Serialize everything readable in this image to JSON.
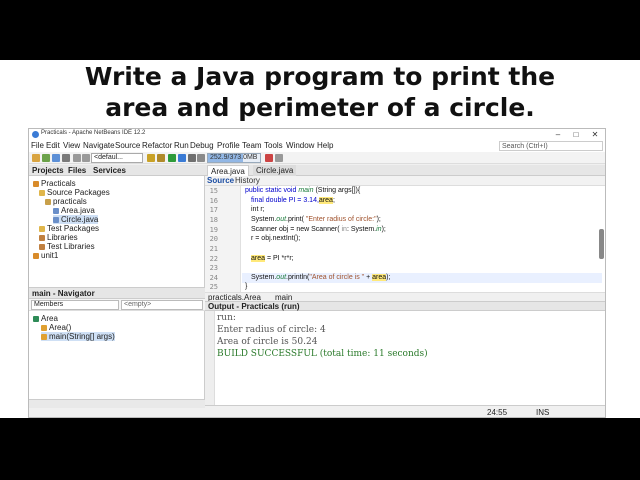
{
  "banner": {
    "line1": "Write a Java program to print the",
    "line2": "area and perimeter of a circle."
  },
  "window": {
    "title": "Practicals - Apache NetBeans IDE 12.2",
    "min": "–",
    "max": "□",
    "close": "✕"
  },
  "menu": [
    "File",
    "Edit",
    "View",
    "Navigate",
    "Source",
    "Refactor",
    "Run",
    "Debug",
    "Profile",
    "Team",
    "Tools",
    "Window",
    "Help"
  ],
  "search": {
    "placeholder": "Search (Ctrl+I)"
  },
  "toolbar": {
    "config": "<defaul...",
    "memory": "252.9/373.0MB",
    "memory_fraction": 0.68
  },
  "projects": {
    "tabs": [
      "Projects",
      "Files",
      "Services"
    ],
    "tree": [
      "Practicals",
      "Source Packages",
      "practicals",
      "Area.java",
      "Circle.java",
      "Test Packages",
      "Libraries",
      "Test Libraries",
      "unit1"
    ]
  },
  "navigator": {
    "title": "main - Navigator",
    "members": "Members",
    "empty": "<empty>",
    "tree": [
      "Area",
      "Area()",
      "main(String[] args)"
    ]
  },
  "editor": {
    "tabs": [
      "Area.java",
      "Circle.java"
    ],
    "source": "Source",
    "history": "History",
    "line_numbers": [
      "15",
      "16",
      "17",
      "18",
      "19",
      "20",
      "21",
      "22",
      "23",
      "24",
      "25"
    ],
    "code": {
      "l15a": "public static void ",
      "l15b": "main",
      "l15c": " (String args[]){",
      "l16a": "final  double PI = 3.14,",
      "l16b": "area",
      "l17": "int r;",
      "l18a": "System.",
      "l18b": "out",
      "l18c": ".print( ",
      "l18d": "\"Enter radius of circle:\"",
      "l18e": ");",
      "l19a": "Scanner obj = new Scanner( ",
      "l19b": "in",
      "l19c": ": System.",
      "l19d": "in",
      "l19e": ");",
      "l20": "r = obj.nextInt();",
      "l22a": "area",
      "l22b": " = PI *r*r;",
      "l24a": "System.",
      "l24b": "out",
      "l24c": ".println(",
      "l24d": "\"Area of circle is \"",
      "l24e": " + ",
      "l24f": "area",
      "l24g": ");",
      "l25": "}"
    },
    "crumbs": [
      "practicals.Area",
      "main"
    ]
  },
  "output": {
    "title": "Output - Practicals (run)",
    "lines": [
      "run:",
      "Enter radius of circle:  4",
      "Area of circle is 50.24",
      "BUILD SUCCESSFUL (total time: 11 seconds)"
    ]
  },
  "status": {
    "position": "24:55",
    "mode": "INS"
  }
}
